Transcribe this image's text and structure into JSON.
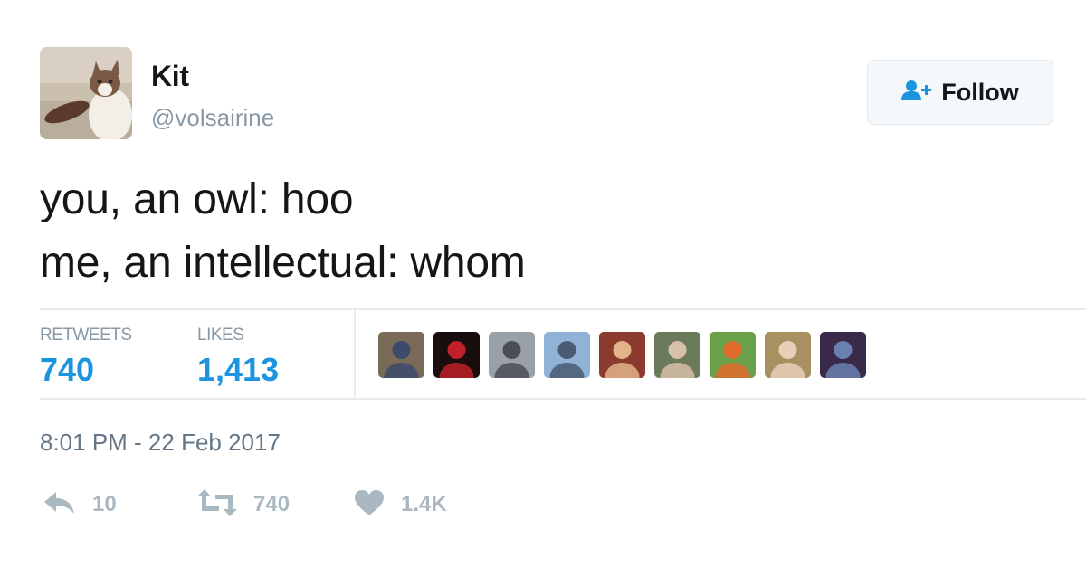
{
  "user": {
    "display_name": "Kit",
    "handle": "@volsairine"
  },
  "follow_button": {
    "label": "Follow",
    "icon": "follow-user-icon"
  },
  "tweet": {
    "lines": [
      "you, an owl: hoo",
      "me, an intellectual: whom"
    ],
    "timestamp": "8:01 PM - 22 Feb 2017"
  },
  "stats": {
    "retweets_label": "RETWEETS",
    "retweets_value": "740",
    "likes_label": "LIKES",
    "likes_value": "1,413"
  },
  "likers": [
    {
      "name": "liker-avatar-1",
      "colors": [
        "#7a6a58",
        "#3d4a6b"
      ]
    },
    {
      "name": "liker-avatar-2",
      "colors": [
        "#1a0d0d",
        "#c0202a"
      ]
    },
    {
      "name": "liker-avatar-3",
      "colors": [
        "#9aa0a8",
        "#4a4f57"
      ]
    },
    {
      "name": "liker-avatar-4",
      "colors": [
        "#8fb2d6",
        "#4a5a70"
      ]
    },
    {
      "name": "liker-avatar-5",
      "colors": [
        "#8b3a2e",
        "#e2b48a"
      ]
    },
    {
      "name": "liker-avatar-6",
      "colors": [
        "#6b7a5a",
        "#d6c0a8"
      ]
    },
    {
      "name": "liker-avatar-7",
      "colors": [
        "#6ba04a",
        "#e06a2a"
      ]
    },
    {
      "name": "liker-avatar-8",
      "colors": [
        "#a89060",
        "#e8d0b8"
      ]
    },
    {
      "name": "liker-avatar-9",
      "colors": [
        "#3a2a4a",
        "#6a80b0"
      ]
    }
  ],
  "actions": {
    "reply_count": "10",
    "retweet_count": "740",
    "like_count": "1.4K"
  },
  "colors": {
    "accent": "#1b95e0",
    "muted": "#8899a6",
    "action_gray": "#aab8c2",
    "text": "#14171a",
    "divider": "#e6ecf0"
  }
}
